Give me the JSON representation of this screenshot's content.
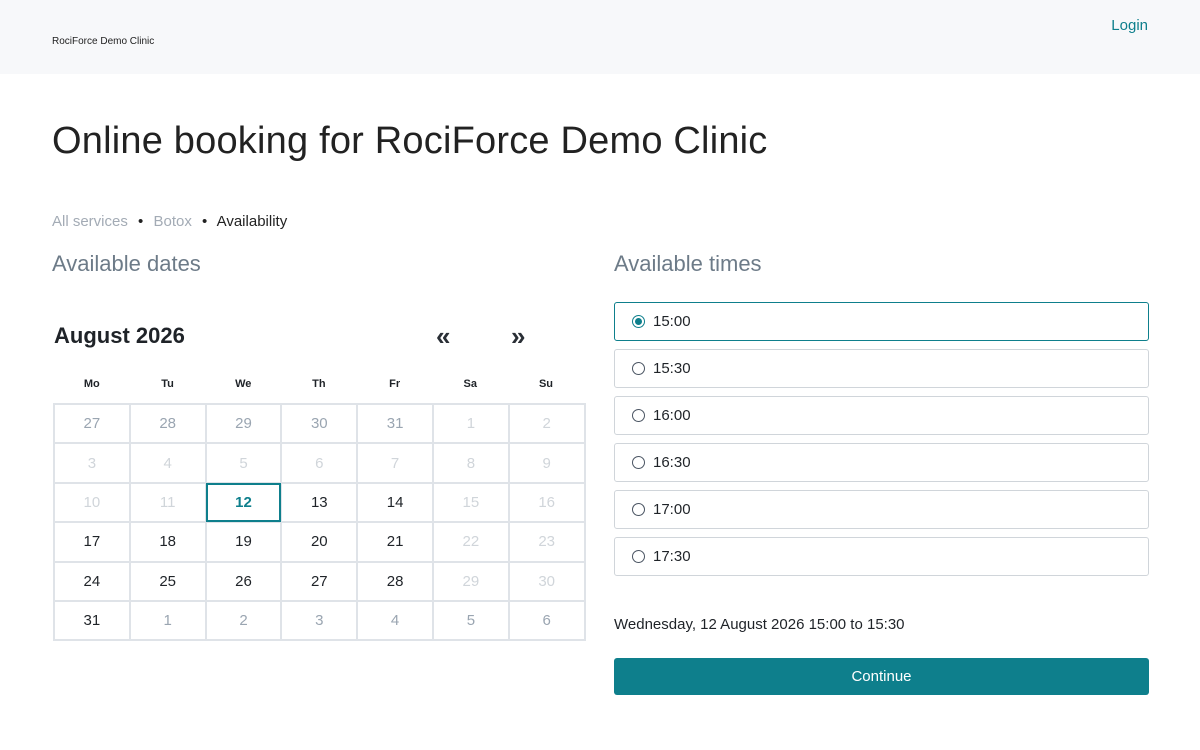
{
  "header": {
    "brand": "RociForce Demo Clinic",
    "login_label": "Login"
  },
  "page_title": "Online booking for RociForce Demo Clinic",
  "breadcrumb": {
    "items": [
      "All services",
      "Botox"
    ],
    "current": "Availability",
    "separator": "•"
  },
  "dates": {
    "heading": "Available dates",
    "month": "August 2026",
    "prev_label": "«",
    "next_label": "»",
    "weekdays": [
      "Mo",
      "Tu",
      "We",
      "Th",
      "Fr",
      "Sa",
      "Su"
    ],
    "weeks": [
      [
        {
          "d": "27",
          "s": "past"
        },
        {
          "d": "28",
          "s": "past"
        },
        {
          "d": "29",
          "s": "past"
        },
        {
          "d": "30",
          "s": "past"
        },
        {
          "d": "31",
          "s": "past"
        },
        {
          "d": "1",
          "s": "dis"
        },
        {
          "d": "2",
          "s": "dis"
        }
      ],
      [
        {
          "d": "3",
          "s": "dis"
        },
        {
          "d": "4",
          "s": "dis"
        },
        {
          "d": "5",
          "s": "dis"
        },
        {
          "d": "6",
          "s": "dis"
        },
        {
          "d": "7",
          "s": "dis"
        },
        {
          "d": "8",
          "s": "dis"
        },
        {
          "d": "9",
          "s": "dis"
        }
      ],
      [
        {
          "d": "10",
          "s": "dis"
        },
        {
          "d": "11",
          "s": "dis"
        },
        {
          "d": "12",
          "s": "sel"
        },
        {
          "d": "13",
          "s": "avail"
        },
        {
          "d": "14",
          "s": "avail"
        },
        {
          "d": "15",
          "s": "dis"
        },
        {
          "d": "16",
          "s": "dis"
        }
      ],
      [
        {
          "d": "17",
          "s": "avail"
        },
        {
          "d": "18",
          "s": "avail"
        },
        {
          "d": "19",
          "s": "avail"
        },
        {
          "d": "20",
          "s": "avail"
        },
        {
          "d": "21",
          "s": "avail"
        },
        {
          "d": "22",
          "s": "dis"
        },
        {
          "d": "23",
          "s": "dis"
        }
      ],
      [
        {
          "d": "24",
          "s": "avail"
        },
        {
          "d": "25",
          "s": "avail"
        },
        {
          "d": "26",
          "s": "avail"
        },
        {
          "d": "27",
          "s": "avail"
        },
        {
          "d": "28",
          "s": "avail"
        },
        {
          "d": "29",
          "s": "dis"
        },
        {
          "d": "30",
          "s": "dis"
        }
      ],
      [
        {
          "d": "31",
          "s": "avail"
        },
        {
          "d": "1",
          "s": "next"
        },
        {
          "d": "2",
          "s": "next"
        },
        {
          "d": "3",
          "s": "next"
        },
        {
          "d": "4",
          "s": "next"
        },
        {
          "d": "5",
          "s": "next"
        },
        {
          "d": "6",
          "s": "next"
        }
      ]
    ]
  },
  "times": {
    "heading": "Available times",
    "options": [
      {
        "label": "15:00",
        "selected": true
      },
      {
        "label": "15:30",
        "selected": false
      },
      {
        "label": "16:00",
        "selected": false
      },
      {
        "label": "16:30",
        "selected": false
      },
      {
        "label": "17:00",
        "selected": false
      },
      {
        "label": "17:30",
        "selected": false
      }
    ]
  },
  "summary": "Wednesday, 12 August 2026 15:00 to 15:30",
  "continue_label": "Continue",
  "colors": {
    "accent": "#0e7f8c",
    "header_bg": "#f7f8fa",
    "muted_text": "#a3abb5",
    "heading_text": "#6d7b88"
  }
}
